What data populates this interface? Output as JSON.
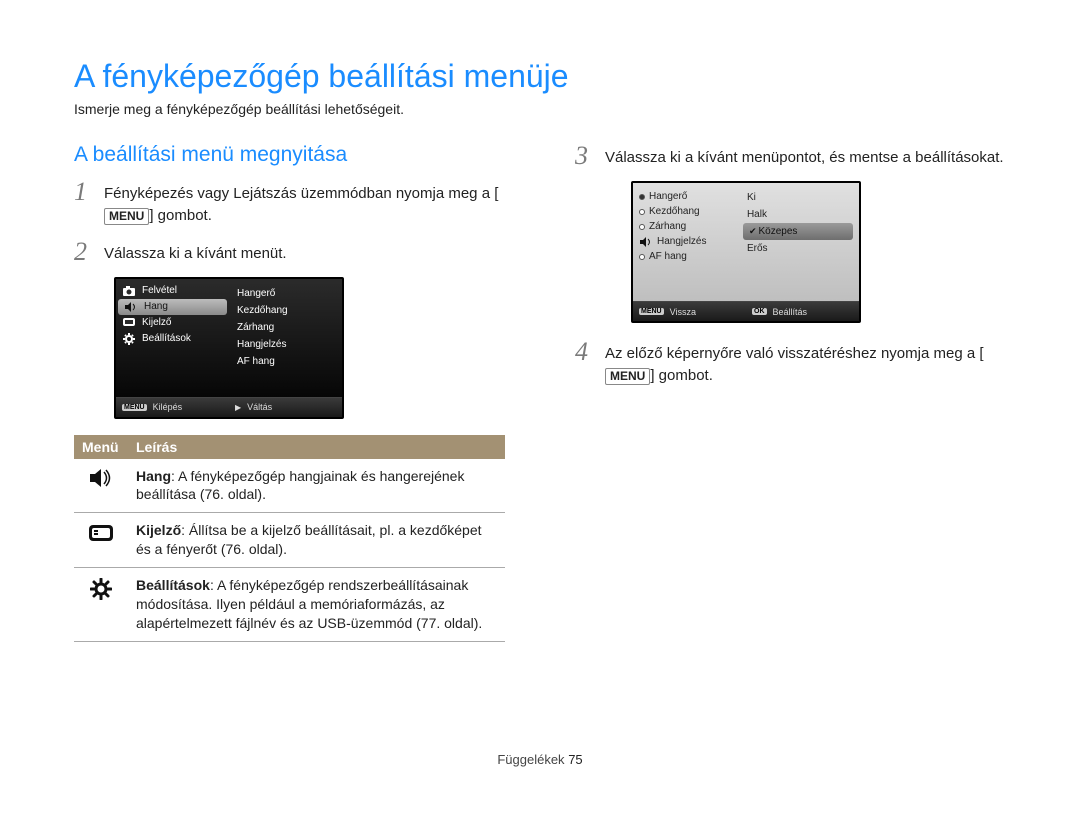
{
  "title": "A fényképezőgép beállítási menüje",
  "subtitle": "Ismerje meg a fényképezőgép beállítási lehetőségeit.",
  "section_head": "A beállítási menü megnyitása",
  "steps": {
    "s1a": "Fényképezés vagy Lejátszás üzemmódban nyomja meg a [",
    "s1b": "] gombot.",
    "s2": "Válassza ki a kívánt menüt.",
    "s3": "Válassza ki a kívánt menüpontot, és mentse a beállításokat.",
    "s4a": "Az előző képernyőre való visszatéréshez nyomja meg a [",
    "s4b": "] gombot."
  },
  "menu_key": "MENU",
  "ok_key": "OK",
  "lcd1": {
    "left": [
      "Felvétel",
      "Hang",
      "Kijelző",
      "Beállítások"
    ],
    "right": [
      "Hangerő",
      "Kezdőhang",
      "Zárhang",
      "Hangjelzés",
      "AF hang"
    ],
    "foot_left": "Kilépés",
    "foot_right": "Váltás"
  },
  "lcd2": {
    "left": [
      "Hangerő",
      "Kezdőhang",
      "Zárhang",
      "Hangjelzés",
      "AF hang"
    ],
    "right": [
      "Ki",
      "Halk",
      "Közepes",
      "Erős"
    ],
    "foot_left": "Vissza",
    "foot_right": "Beállítás"
  },
  "desc_table": {
    "head_menu": "Menü",
    "head_desc": "Leírás",
    "rows": [
      {
        "bold": "Hang",
        "text": ": A fényképezőgép hangjainak és hangerejének beállítása (76. oldal)."
      },
      {
        "bold": "Kijelző",
        "text": ": Állítsa be a kijelző beállításait, pl. a kezdőképet és a fényerőt (76. oldal)."
      },
      {
        "bold": "Beállítások",
        "text": ": A fényképezőgép rendszerbeállításainak módosítása. Ilyen például a memóriaformázás, az alapértelmezett fájlnév és az USB-üzemmód (77. oldal)."
      }
    ]
  },
  "footer": {
    "label": "Függelékek",
    "page": "75"
  }
}
